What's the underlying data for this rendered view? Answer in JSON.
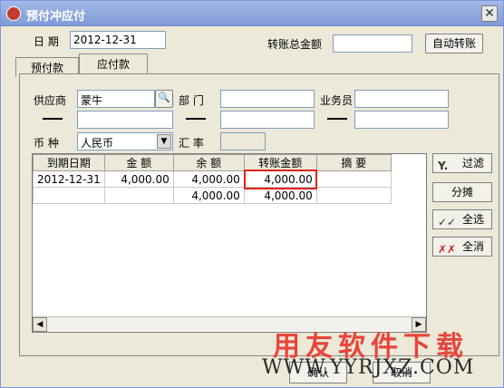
{
  "window": {
    "title": "预付冲应付",
    "close": "✕"
  },
  "header": {
    "date_label": "日  期",
    "date_value": "2012-12-31",
    "transfer_total_label": "转账总金额",
    "transfer_total_value": "",
    "auto_transfer_label": "自动转账"
  },
  "tabs": [
    {
      "label": "预付款"
    },
    {
      "label": "应付款"
    }
  ],
  "filters": {
    "supplier_label": "供应商",
    "supplier_value": "蒙牛",
    "dept_label": "部  门",
    "dept_value": "",
    "salesman_label": "业务员",
    "salesman_value": "",
    "currency_label": "币  种",
    "currency_value": "人民币",
    "rate_label": "汇  率",
    "rate_value": ""
  },
  "grid": {
    "columns": [
      "到期日期",
      "金    额",
      "余    额",
      "转账金额",
      "摘    要"
    ],
    "rows": [
      {
        "date": "2012-12-31",
        "amount": "4,000.00",
        "balance": "4,000.00",
        "transfer": "4,000.00",
        "memo": ""
      },
      {
        "date": "",
        "amount": "",
        "balance": "4,000.00",
        "transfer": "4,000.00",
        "memo": ""
      }
    ]
  },
  "side_buttons": {
    "filter": "过滤",
    "split": "分摊",
    "select_all": "全选",
    "clear_all": "全消"
  },
  "footer": {
    "ok": "确认",
    "cancel": "取消"
  },
  "watermark": {
    "cn": "用友软件下载",
    "url": "WWW.YYRJXZ.COM"
  },
  "colors": {
    "highlight": "#e0251c",
    "titlebar": "#7f9bd8"
  }
}
